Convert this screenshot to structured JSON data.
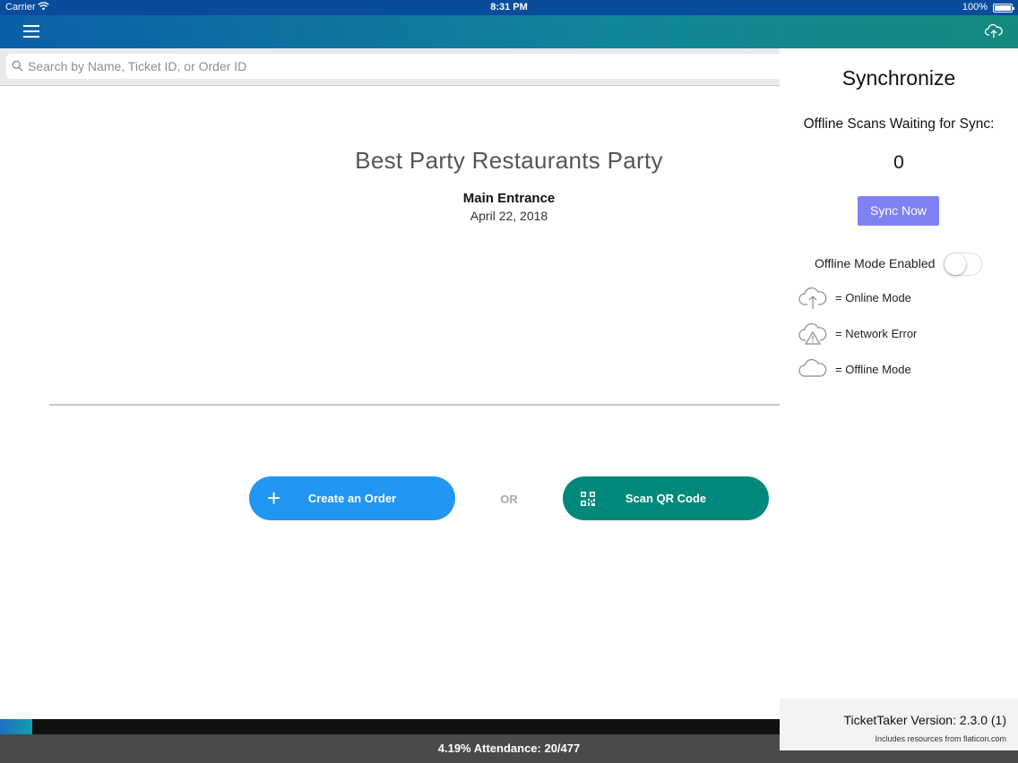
{
  "status_bar": {
    "carrier": "Carrier",
    "time": "8:31 PM",
    "battery": "100%"
  },
  "nav": {
    "menu_icon": "hamburger-menu-icon",
    "sync_icon": "cloud-upload-icon"
  },
  "search": {
    "placeholder": "Search by Name, Ticket ID, or Order ID",
    "value": ""
  },
  "event": {
    "title": "Best Party Restaurants Party",
    "gate": "Main Entrance",
    "date": "April 22, 2018"
  },
  "actions": {
    "create_order": "Create an Order",
    "or": "OR",
    "scan_qr": "Scan QR Code"
  },
  "footer": {
    "attendance": "4.19% Attendance: 20/477",
    "attendance_fraction": 0.0419
  },
  "sync_panel": {
    "title": "Synchronize",
    "offline_scans_label": "Offline Scans Waiting for Sync:",
    "offline_scans_count": "0",
    "sync_button": "Sync Now",
    "offline_mode_label": "Offline Mode Enabled",
    "offline_mode_enabled": false,
    "legend": [
      {
        "icon": "cloud-upload-icon",
        "text": "=  Online Mode"
      },
      {
        "icon": "cloud-warning-icon",
        "text": "=  Network Error"
      },
      {
        "icon": "cloud-icon",
        "text": "=  Offline Mode"
      }
    ],
    "version": "TicketTaker Version:  2.3.0 (1)",
    "credits": "Includes resources from flaticon.com"
  },
  "colors": {
    "status_bar": "#0a4c9c",
    "create_order": "#2196f3",
    "scan_qr": "#00897b",
    "sync_button": "#8080f5",
    "footer": "#4a4a4a"
  }
}
